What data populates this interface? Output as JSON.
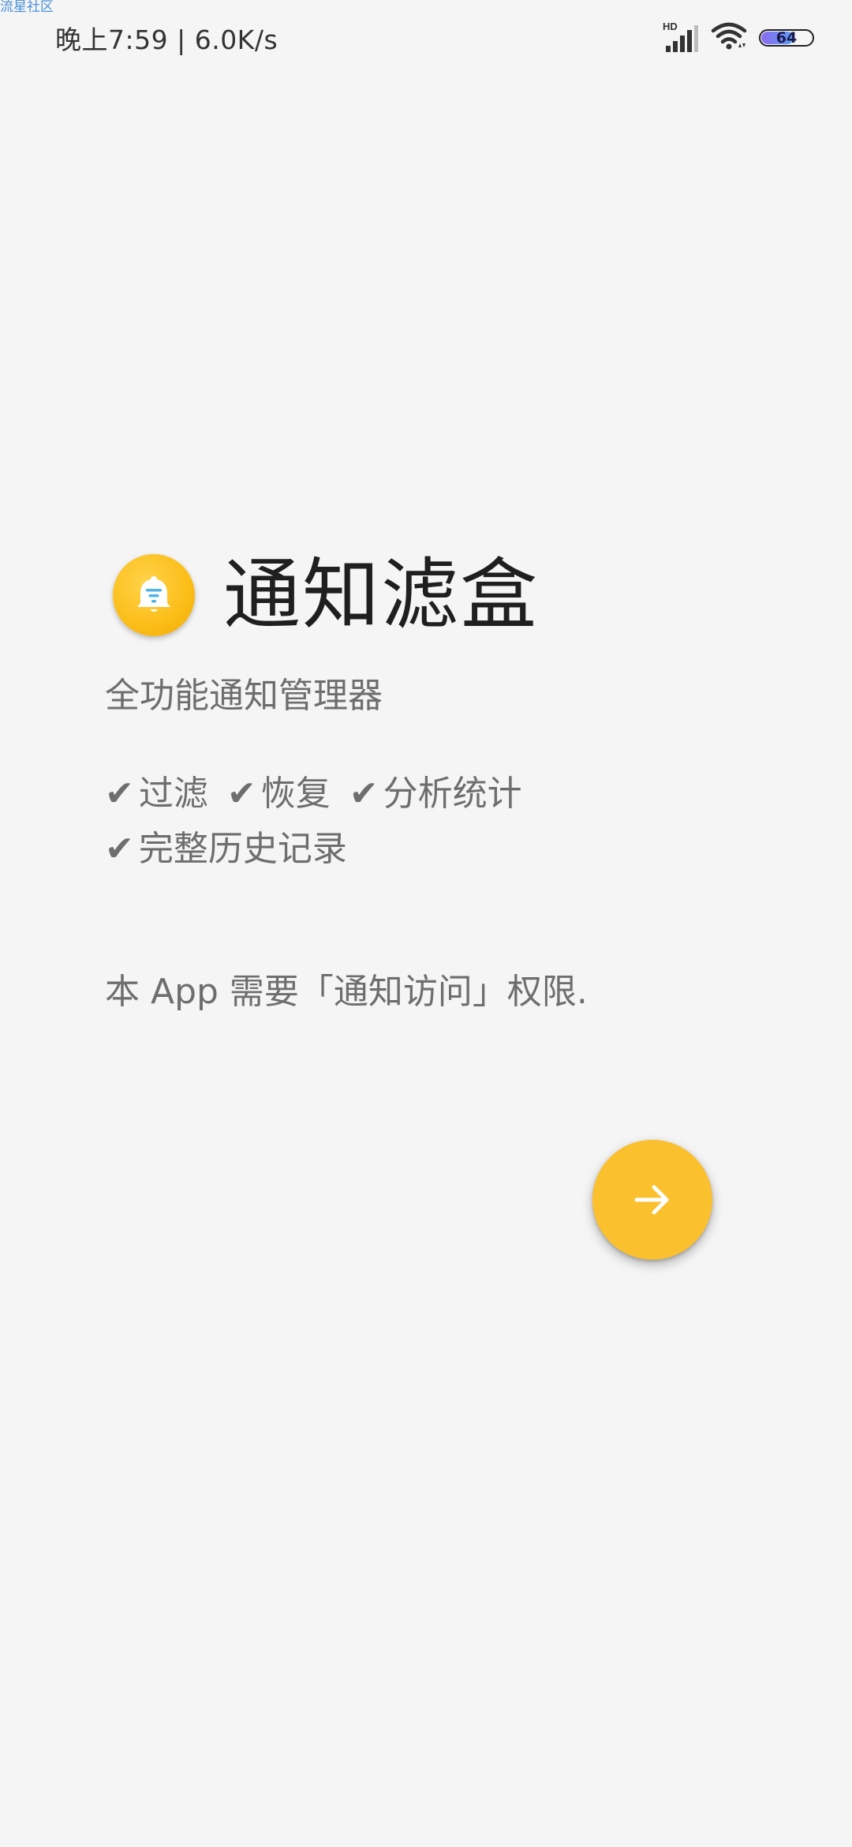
{
  "watermark": "流星社区",
  "status_bar": {
    "time": "晚上7:59 | 6.0K/s",
    "signal_label": "HD",
    "signal_icon": "cellular-signal-icon",
    "wifi_icon": "wifi-icon",
    "battery_level": "64",
    "battery_percent": 64
  },
  "app": {
    "icon": "bell-filter-icon",
    "title": "通知滤盒",
    "subtitle": "全功能通知管理器"
  },
  "features": {
    "check_symbol": "✔",
    "line1": [
      "过滤",
      "恢复",
      "分析统计"
    ],
    "line2": [
      "完整历史记录"
    ]
  },
  "permission_text": "本 App 需要「通知访问」权限.",
  "next_button": {
    "icon": "arrow-right-icon",
    "color": "#fbc02d"
  },
  "colors": {
    "background": "#f5f5f5",
    "accent": "#fbc02d",
    "title": "#1f1f1f",
    "body_text": "#6e6e6e"
  }
}
